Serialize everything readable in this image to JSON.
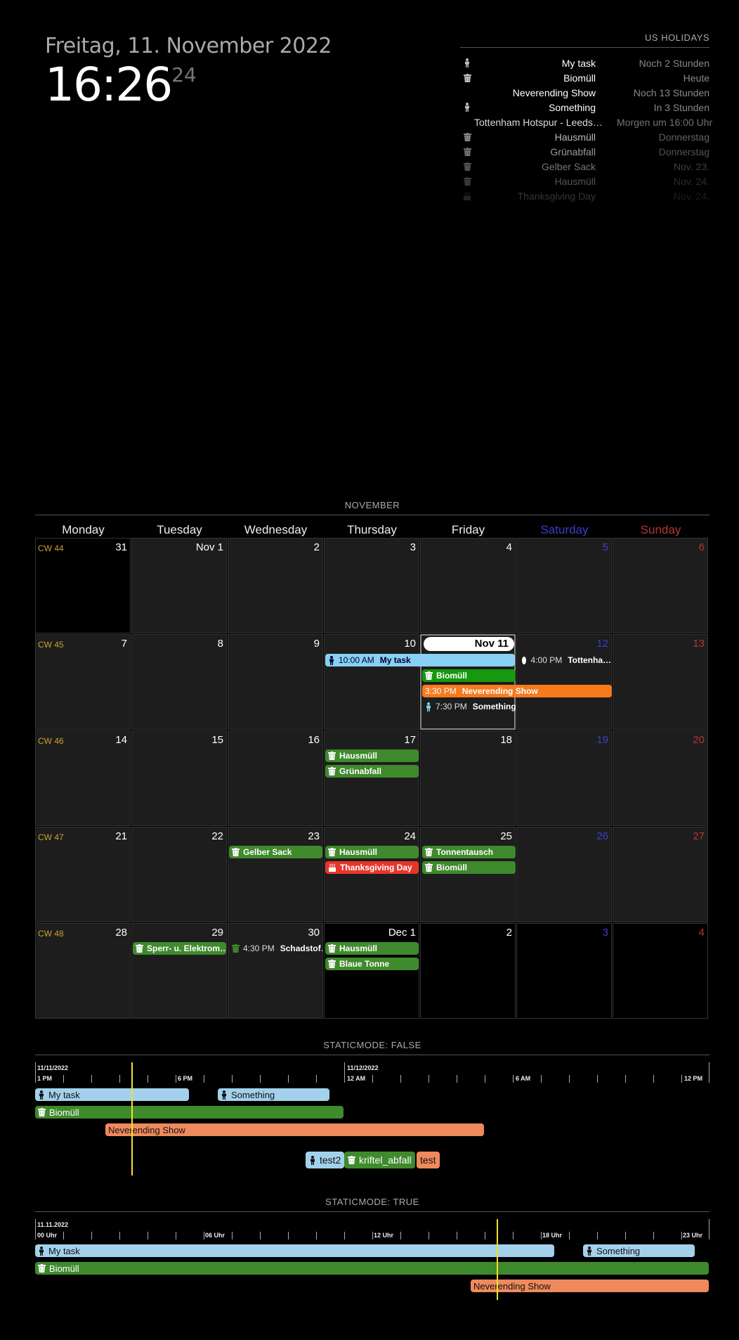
{
  "clock": {
    "date": "Freitag, 11. November 2022",
    "time": "16:26",
    "seconds": "24"
  },
  "holidays": {
    "header": "US HOLIDAYS",
    "items": [
      {
        "icon": "person-icon",
        "title": "My task",
        "time": "Noch 2 Stunden"
      },
      {
        "icon": "trash-icon",
        "title": "Biomüll",
        "time": "Heute"
      },
      {
        "icon": "none",
        "title": "Neverending Show",
        "time": "Noch 13 Stunden"
      },
      {
        "icon": "person-icon",
        "title": "Something",
        "time": "In 3 Stunden"
      },
      {
        "icon": "none",
        "title": "Tottenham Hotspur - Leeds…",
        "time": "Morgen um 16:00 Uhr"
      },
      {
        "icon": "trash-icon",
        "title": "Hausmüll",
        "time": "Donnerstag"
      },
      {
        "icon": "trash-icon",
        "title": "Grünabfall",
        "time": "Donnerstag"
      },
      {
        "icon": "trash-icon",
        "title": "Gelber Sack",
        "time": "Nov. 23."
      },
      {
        "icon": "trash-icon",
        "title": "Hausmüll",
        "time": "Nov. 24."
      },
      {
        "icon": "cake-icon",
        "title": "Thanksgiving Day",
        "time": "Nov. 24."
      }
    ]
  },
  "calendar": {
    "header": "NOVEMBER",
    "weekdays": [
      "Monday",
      "Tuesday",
      "Wednesday",
      "Thursday",
      "Friday",
      "Saturday",
      "Sunday"
    ],
    "weeks": [
      {
        "cw": "CW 44",
        "days": [
          "31",
          "Nov 1",
          "2",
          "3",
          "4",
          "5",
          "6"
        ]
      },
      {
        "cw": "CW 45",
        "days": [
          "7",
          "8",
          "9",
          "10",
          "Nov 11",
          "12",
          "13"
        ]
      },
      {
        "cw": "CW 46",
        "days": [
          "14",
          "15",
          "16",
          "17",
          "18",
          "19",
          "20"
        ]
      },
      {
        "cw": "CW 47",
        "days": [
          "21",
          "22",
          "23",
          "24",
          "25",
          "26",
          "27"
        ]
      },
      {
        "cw": "CW 48",
        "days": [
          "28",
          "29",
          "30",
          "Dec 1",
          "2",
          "3",
          "4"
        ]
      }
    ],
    "events": {
      "mytask": {
        "time": "10:00 AM",
        "title": "My task"
      },
      "tottenham": {
        "time": "4:00 PM",
        "title": "Tottenha…"
      },
      "biomuell11": {
        "title": "Biomüll"
      },
      "neverending": {
        "time": "3:30 PM",
        "title": "Neverending Show"
      },
      "something": {
        "time": "7:30 PM",
        "title": "Something"
      },
      "hausmuell17": {
        "title": "Hausmüll"
      },
      "gruen17": {
        "title": "Grünabfall"
      },
      "gelber23": {
        "title": "Gelber Sack"
      },
      "hausmuell24": {
        "title": "Hausmüll"
      },
      "thanks24": {
        "title": "Thanksgiving Day"
      },
      "tonnen25": {
        "title": "Tonnentausch"
      },
      "biomuell25": {
        "title": "Biomüll"
      },
      "sperr29": {
        "title": "Sperr- u. Elektrom…"
      },
      "schad30": {
        "time": "4:30 PM",
        "title": "Schadstof…"
      },
      "hausmuell1": {
        "title": "Hausmüll"
      },
      "blaue1": {
        "title": "Blaue Tonne"
      }
    }
  },
  "timeline1": {
    "header": "STATICMODE: FALSE",
    "date_left": "11/11/2022",
    "date_mid": "11/12/2022",
    "labels": [
      "1 PM",
      "6 PM",
      "12 AM",
      "6 AM",
      "12 PM"
    ],
    "bars": {
      "mytask": "My task",
      "something": "Something",
      "bio": "Biomüll",
      "never": "Neverending Show"
    },
    "chips": [
      "test2",
      "kriftel_abfall",
      "test"
    ]
  },
  "timeline2": {
    "header": "STATICMODE: TRUE",
    "date_left": "11.11.2022",
    "labels": [
      "00 Uhr",
      "06 Uhr",
      "12 Uhr",
      "18 Uhr",
      "23 Uhr"
    ],
    "bars": {
      "mytask": "My task",
      "something": "Something",
      "bio": "Biomüll",
      "never": "Neverending Show"
    }
  },
  "colors": {
    "green": "#3f8a2c",
    "lightblue": "#a3d1ec",
    "orange": "#f77a1d",
    "salmon": "#ef8a5d",
    "red": "#e6362b",
    "cw": "#c9a031",
    "saturday": "#3d3dc9",
    "sunday": "#b33636",
    "nowline": "#f6de2c"
  }
}
